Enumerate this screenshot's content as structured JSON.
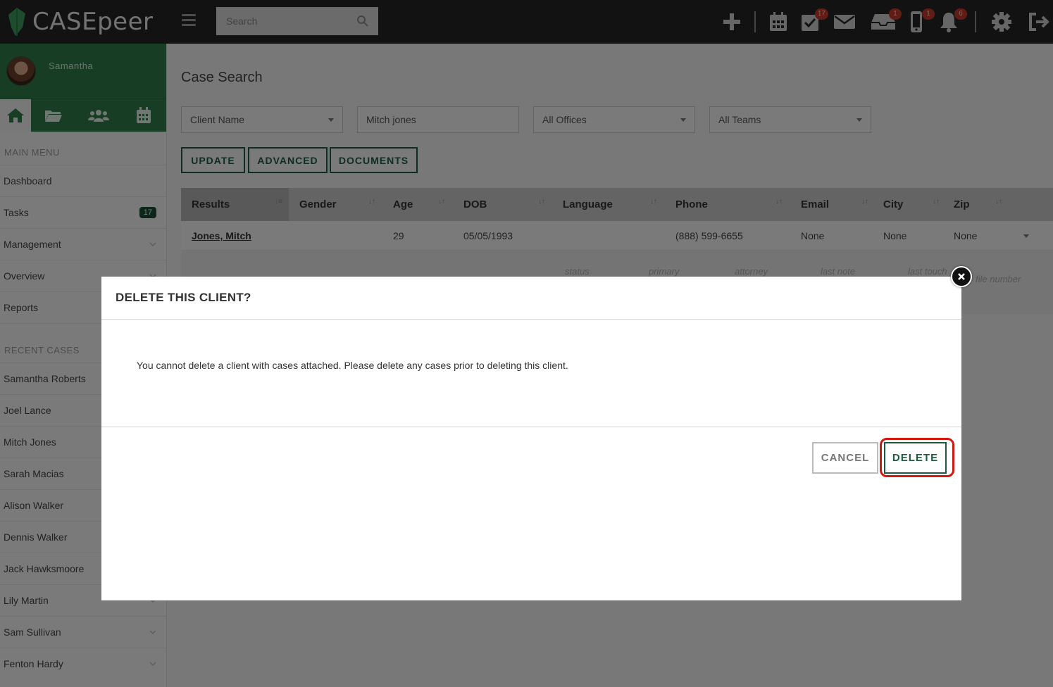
{
  "app": {
    "logo_text": "CASEpeer",
    "brand_color": "#2f7d4b",
    "accent_color": "#1e5a40"
  },
  "topbar": {
    "search_placeholder": "Search",
    "icons": [
      {
        "name": "plus-icon"
      },
      {
        "name": "calendar-icon"
      },
      {
        "name": "tasks-check-icon",
        "badge": "17"
      },
      {
        "name": "mail-icon"
      },
      {
        "name": "inbox-icon",
        "badge": "1"
      },
      {
        "name": "phone-icon",
        "badge": "1"
      },
      {
        "name": "bell-icon",
        "badge": "6"
      },
      {
        "name": "gear-icon"
      },
      {
        "name": "logout-icon"
      }
    ]
  },
  "sidebar": {
    "user_name": "Samantha",
    "tabs": [
      "home-icon",
      "folder-icon",
      "team-icon",
      "calendar-icon"
    ],
    "main_menu_label": "MAIN MENU",
    "main_menu": [
      {
        "label": "Dashboard"
      },
      {
        "label": "Tasks",
        "badge": "17"
      },
      {
        "label": "Management",
        "chevron": true
      },
      {
        "label": "Overview",
        "chevron": true
      },
      {
        "label": "Reports"
      }
    ],
    "recent_label": "RECENT CASES",
    "recent_cases": [
      {
        "label": "Samantha Roberts"
      },
      {
        "label": "Joel Lance"
      },
      {
        "label": "Mitch Jones"
      },
      {
        "label": "Sarah Macias"
      },
      {
        "label": "Alison Walker"
      },
      {
        "label": "Dennis Walker"
      },
      {
        "label": "Jack Hawksmoore"
      },
      {
        "label": "Lily Martin",
        "chevron": true
      },
      {
        "label": "Sam Sullivan",
        "chevron": true
      },
      {
        "label": "Fenton Hardy",
        "chevron": true
      }
    ]
  },
  "main": {
    "title": "Case Search",
    "filters": {
      "search_by": "Client Name",
      "query": "Mitch jones",
      "office": "All Offices",
      "team": "All Teams"
    },
    "buttons": {
      "update": "UPDATE",
      "advanced": "ADVANCED",
      "documents": "DOCUMENTS"
    },
    "table": {
      "columns": [
        "Results",
        "Gender",
        "Age",
        "DOB",
        "Language",
        "Phone",
        "Email",
        "City",
        "Zip"
      ],
      "rows": [
        {
          "name": "Jones, Mitch",
          "gender": "",
          "age": "29",
          "dob": "05/05/1993",
          "language": "",
          "phone": "(888) 599-6655",
          "email": "None",
          "city": "None",
          "zip": "None"
        }
      ],
      "sub_labels": [
        "status",
        "primary",
        "attorney",
        "last note",
        "last touch",
        "file number"
      ]
    }
  },
  "modal": {
    "title": "DELETE THIS CLIENT?",
    "message": "You cannot delete a client with cases attached. Please delete any cases prior to deleting this client.",
    "cancel_label": "CANCEL",
    "delete_label": "DELETE"
  }
}
